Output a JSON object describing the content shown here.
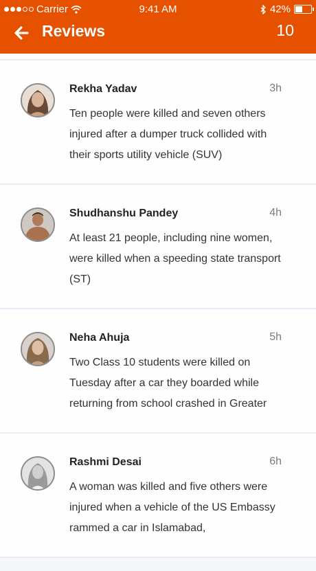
{
  "status_bar": {
    "carrier": "Carrier",
    "time": "9:41 AM",
    "battery": "42%"
  },
  "header": {
    "title": "Reviews",
    "count": "10"
  },
  "reviews": [
    {
      "name": "Rekha Yadav",
      "time": "3h",
      "text": "Ten people were killed and seven others injured after a dumper truck collided with their sports utility vehicle (SUV)"
    },
    {
      "name": "Shudhanshu Pandey",
      "time": "4h",
      "text": "At least 21 people, including nine women, were killed when a speeding state transport (ST)"
    },
    {
      "name": "Neha Ahuja",
      "time": "5h",
      "text": "Two Class 10 students were killed on Tuesday after a car they boarded while returning from school crashed in Greater"
    },
    {
      "name": "Rashmi Desai",
      "time": "6h",
      "text": "A woman was killed and five others were injured when a vehicle of the US Embassy rammed a car in Islamabad,"
    }
  ],
  "colors": {
    "accent": "#e65100",
    "divider": "#e3ecf7"
  }
}
